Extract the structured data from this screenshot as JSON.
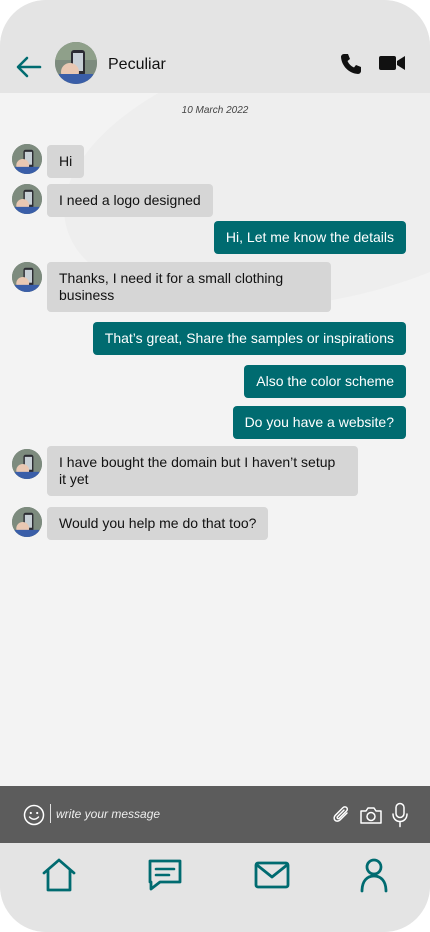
{
  "header": {
    "contact_name": "Peculiar"
  },
  "conversation": {
    "date": "10 March 2022",
    "messages": [
      {
        "direction": "in",
        "text": "Hi"
      },
      {
        "direction": "in",
        "text": "I need a logo designed"
      },
      {
        "direction": "out",
        "text": "Hi, Let me know the details"
      },
      {
        "direction": "in",
        "text": "Thanks, I need it for a small clothing business"
      },
      {
        "direction": "out",
        "text": "That’s great, Share the samples or inspirations"
      },
      {
        "direction": "out",
        "text": "Also the color scheme"
      },
      {
        "direction": "out",
        "text": "Do you have a website?"
      },
      {
        "direction": "in",
        "text": "I have bought the domain but I haven’t setup it yet"
      },
      {
        "direction": "in",
        "text": "Would you help me do that too?"
      }
    ]
  },
  "composer": {
    "placeholder": "write your message",
    "value": ""
  },
  "bottom_nav": {
    "items": [
      {
        "icon": "home-icon"
      },
      {
        "icon": "chat-icon"
      },
      {
        "icon": "mail-icon"
      },
      {
        "icon": "profile-icon"
      }
    ]
  },
  "icons": {
    "back": "arrow-left-icon",
    "call": "phone-icon",
    "video": "video-camera-icon",
    "emoji": "smiley-icon",
    "attach": "paperclip-icon",
    "camera": "camera-icon",
    "mic": "microphone-icon"
  },
  "colors": {
    "accent": "#006b70",
    "incoming_bubble": "#d6d6d6",
    "header_bg": "#e4e4e4",
    "composer_bg": "#5c5c5c"
  }
}
